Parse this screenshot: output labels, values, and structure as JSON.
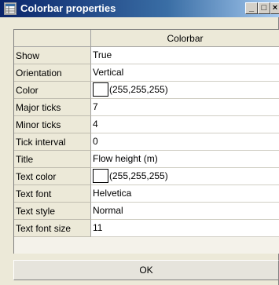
{
  "window": {
    "title": "Colorbar properties",
    "minimize_label": "_",
    "maximize_label": "□",
    "close_label": "×"
  },
  "table": {
    "column_header": "Colorbar",
    "rows": [
      {
        "label": "Show",
        "value": "True"
      },
      {
        "label": "Orientation",
        "value": "Vertical"
      },
      {
        "label": "Color",
        "value": "(255,255,255)",
        "swatch": "#ffffff"
      },
      {
        "label": "Major ticks",
        "value": "7"
      },
      {
        "label": "Minor ticks",
        "value": "4"
      },
      {
        "label": "Tick interval",
        "value": "0"
      },
      {
        "label": "Title",
        "value": "Flow height (m)"
      },
      {
        "label": "Text color",
        "value": "(255,255,255)",
        "swatch": "#ffffff"
      },
      {
        "label": "Text font",
        "value": "Helvetica"
      },
      {
        "label": "Text style",
        "value": "Normal"
      },
      {
        "label": "Text font size",
        "value": "11"
      }
    ]
  },
  "ok_label": "OK",
  "colors": {
    "titlebar_start": "#0a246a",
    "titlebar_end": "#a6caf0",
    "window_bg": "#ece9d8"
  }
}
